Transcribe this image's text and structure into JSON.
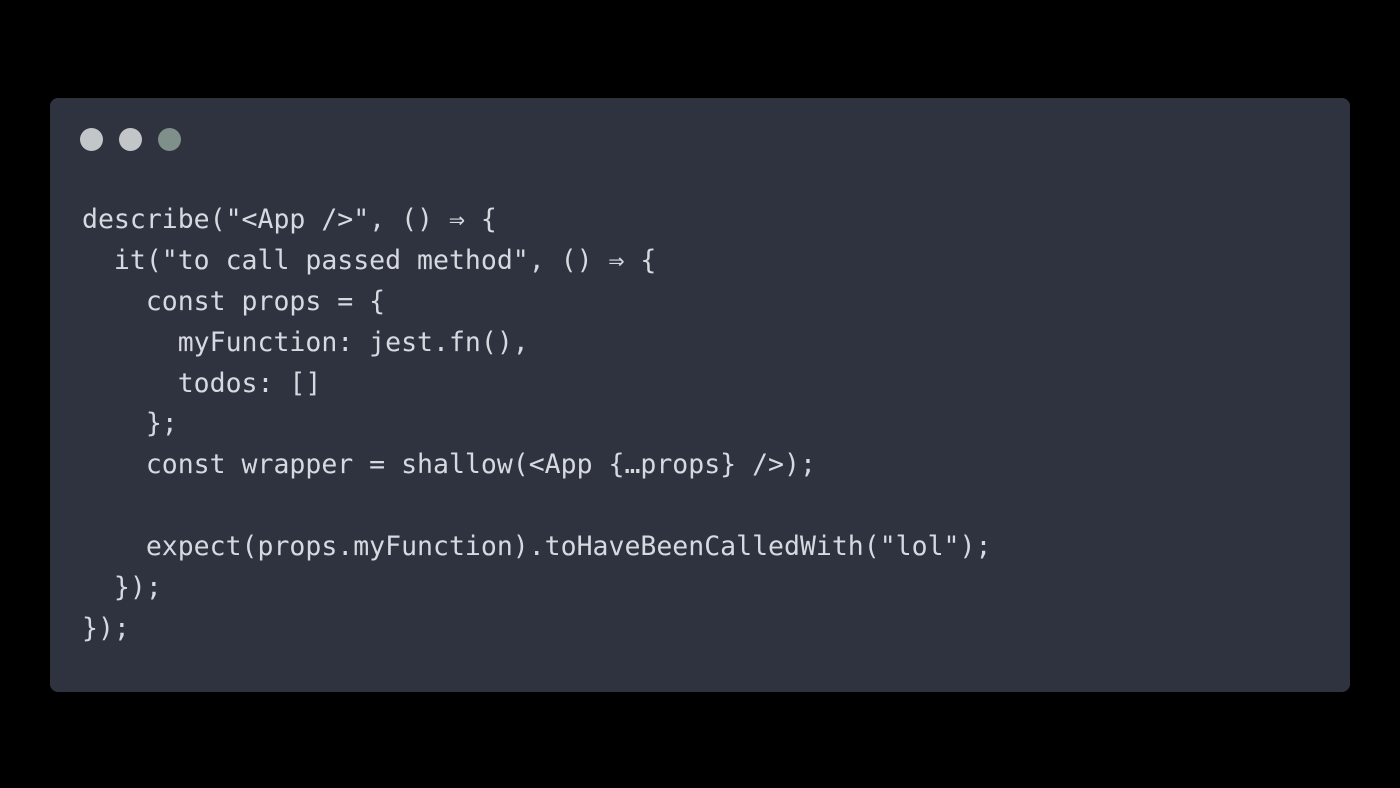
{
  "window": {
    "background": "#2f3340",
    "page_background": "#000000",
    "controls": [
      {
        "name": "close-dot",
        "color": "#c3c6c9"
      },
      {
        "name": "minimize-dot",
        "color": "#c3c6c9"
      },
      {
        "name": "maximize-dot",
        "color": "#7f8f8a"
      }
    ]
  },
  "code": {
    "lines": [
      "describe(\"<App />\", () ⇒ {",
      "  it(\"to call passed method\", () ⇒ {",
      "    const props = {",
      "      myFunction: jest.fn(),",
      "      todos: []",
      "    };",
      "    const wrapper = shallow(<App {…props} />);",
      "",
      "    expect(props.myFunction).toHaveBeenCalledWith(\"lol\");",
      "  });",
      "});"
    ]
  }
}
